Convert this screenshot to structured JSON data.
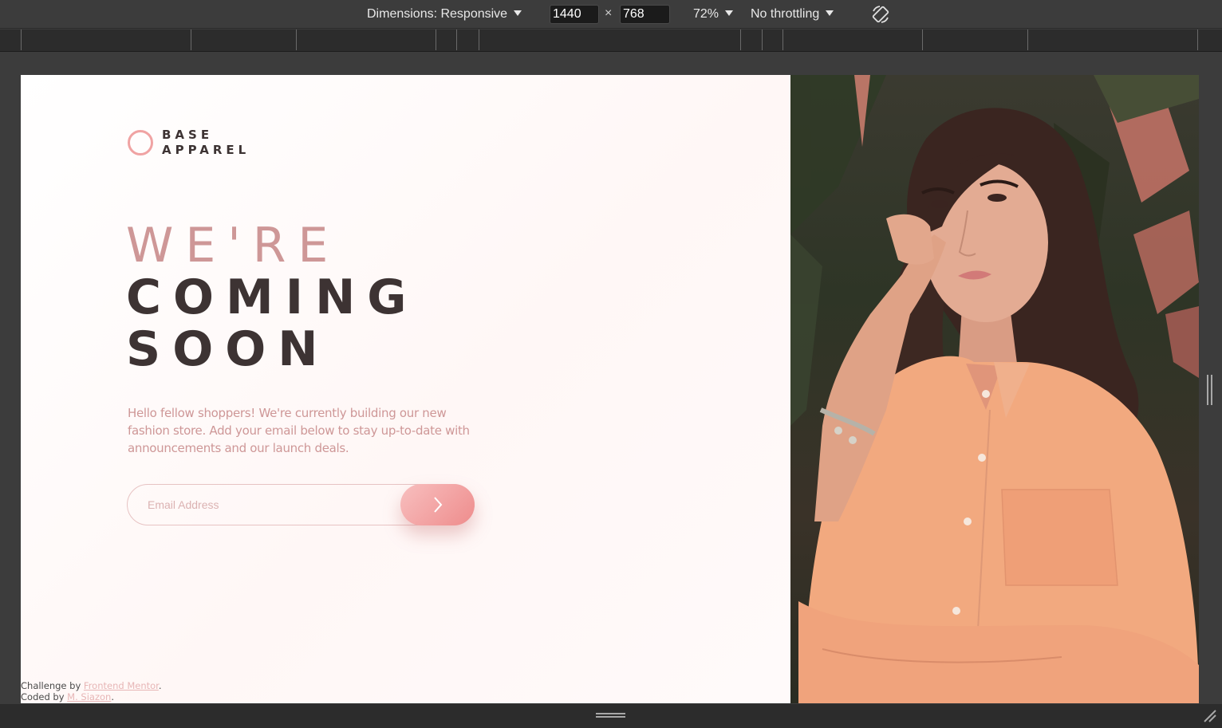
{
  "devtools": {
    "dimensions_label": "Dimensions: Responsive",
    "width_value": "1440",
    "times_symbol": "×",
    "height_value": "768",
    "zoom_label": "72%",
    "throttling_label": "No throttling",
    "rotate_icon": "rotate-icon"
  },
  "page": {
    "brand": {
      "line1": "BASE",
      "line2": "APPAREL",
      "mark": "ring-logo"
    },
    "headline": {
      "line1": "WE'RE",
      "line2": "COMING",
      "line3": "SOON"
    },
    "intro": "Hello fellow shoppers! We're currently building our new fashion store. Add your email below to stay up-to-date with announcements and our launch deals.",
    "form": {
      "email_placeholder": "Email Address",
      "submit_icon": "arrow-right-icon"
    },
    "attribution": {
      "challenge_prefix": "Challenge by ",
      "challenge_link": "Frontend Mentor",
      "coded_prefix": "Coded by ",
      "coded_link": "M. Siazon",
      "period": "."
    },
    "hero_image": "woman-in-peach-shirt-photo"
  },
  "colors": {
    "accent_pink": "#ce9797",
    "dark_text": "#3d3333",
    "button_start": "#f8bfbf",
    "button_end": "#ee8c8c",
    "devtools_bg": "#3c3c3c"
  }
}
